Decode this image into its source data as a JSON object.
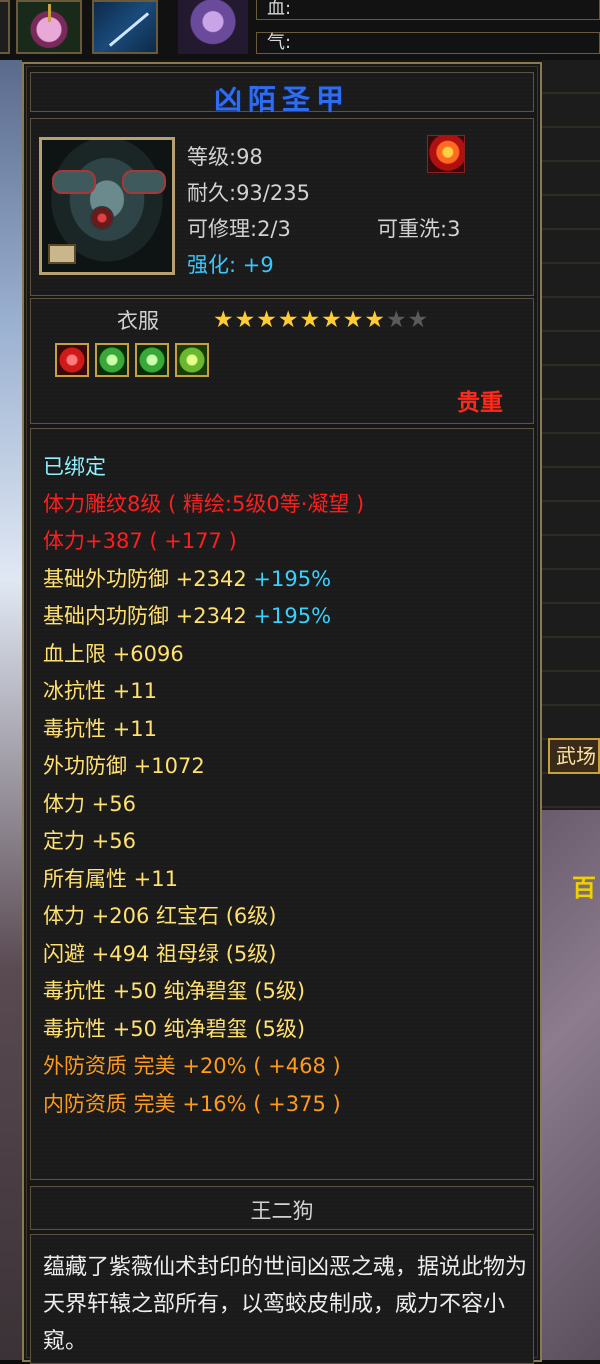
{
  "hud": {
    "blood_label": "血:",
    "qi_label": "气:",
    "side_button": "武场",
    "side_glyph": "百"
  },
  "item": {
    "name": "凶陌圣甲",
    "level": "等级:98",
    "durability": "耐久:93/235",
    "repairable": "可修理:2/3",
    "rewash": "可重洗:3",
    "enhance_label": "强化:",
    "enhance_value": "+9",
    "type": "衣服",
    "stars_total": 10,
    "stars_filled": 8,
    "gems": [
      "red",
      "green",
      "green",
      "green-gold"
    ],
    "rarity": "贵重"
  },
  "attributes": {
    "bound": "已绑定",
    "carve": "体力雕纹8级 ( 精绘:5级0等·凝望 )",
    "stamina_main": "体力+387 ( +177 )",
    "phys_def_base": "基础外功防御 +2342",
    "phys_def_pct": "+195%",
    "inner_def_base": "基础内功防御 +2342",
    "inner_def_pct": "+195%",
    "hp_max": "血上限 +6096",
    "ice_res": "冰抗性 +11",
    "poison_res": "毒抗性 +11",
    "outer_def": "外功防御 +1072",
    "stamina": "体力 +56",
    "focus": "定力 +56",
    "all_attr": "所有属性 +11",
    "gem1": "体力 +206 红宝石 (6级)",
    "gem2": "闪避 +494 祖母绿 (5级)",
    "gem3": "毒抗性 +50 纯净碧玺 (5级)",
    "gem4": "毒抗性 +50 纯净碧玺 (5级)",
    "quality1": "外防资质  完美 +20% ( +468 )",
    "quality2": "内防资质  完美 +16% ( +375 )"
  },
  "maker": "王二狗",
  "description": "蕴藏了紫薇仙术封印的世间凶恶之魂，据说此物为天界轩辕之部所有，以鸾蛟皮制成，威力不容小窥。",
  "colors": {
    "title": "#2e6cf0",
    "rarity": "#ff2a1a",
    "enhance": "#38c8ff",
    "attr_red": "#ff1e1e",
    "attr_yellow": "#ffe070",
    "attr_orange": "#ff9a1a",
    "attr_pct": "#38d0ff"
  }
}
